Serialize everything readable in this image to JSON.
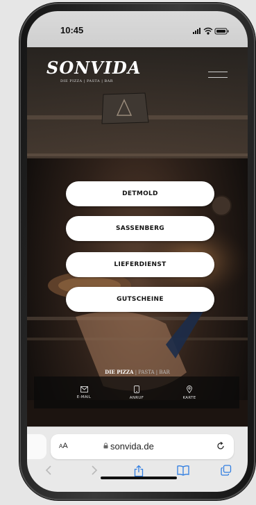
{
  "status_bar": {
    "time": "10:45"
  },
  "header": {
    "logo": "SONVIDA",
    "logo_sub": "DIE PIZZA | PASTA | BAR"
  },
  "nav_buttons": [
    {
      "label": "DETMOLD"
    },
    {
      "label": "SASSENBERG"
    },
    {
      "label": "LIEFERDIENST"
    },
    {
      "label": "GUTSCHEINE"
    }
  ],
  "tagline": {
    "main": "DIE PIZZA",
    "rest": " | PASTA | BAR"
  },
  "contact": [
    {
      "label": "E-MAIL",
      "icon": "envelope-icon"
    },
    {
      "label": "ANRUF",
      "icon": "phone-icon"
    },
    {
      "label": "KARTE",
      "icon": "map-pin-icon"
    }
  ],
  "browser": {
    "aa_label": "AA",
    "url": "sonvida.de",
    "toolbar_icons": [
      "back-icon",
      "forward-icon",
      "share-icon",
      "bookmarks-icon",
      "tabs-icon"
    ]
  }
}
